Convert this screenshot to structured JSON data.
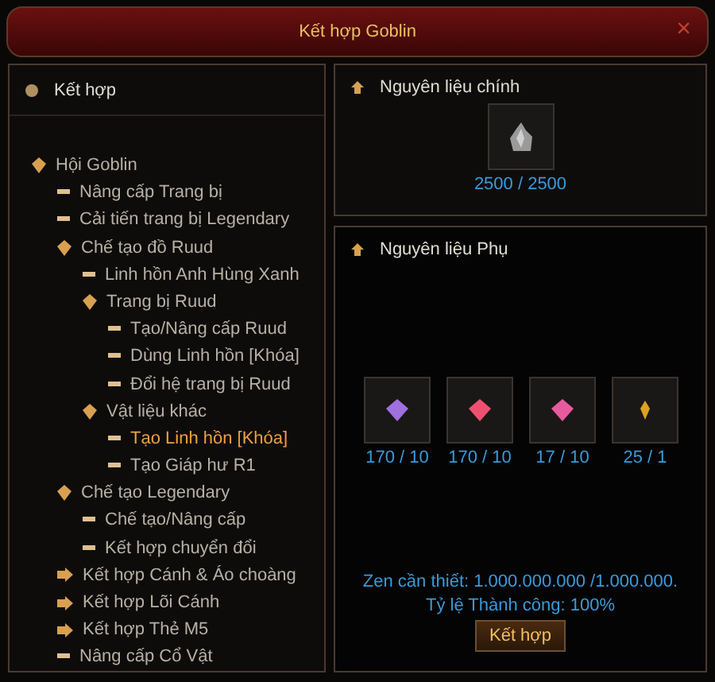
{
  "window": {
    "title": "Kết hợp Goblin",
    "close": "×"
  },
  "sidebar": {
    "title": "Kết hợp",
    "tree": [
      {
        "label": "Hội Goblin",
        "kind": "group",
        "expanded": true,
        "selected": false,
        "children": [
          {
            "label": "Nâng cấp Trang bị",
            "kind": "leaf",
            "selected": false
          },
          {
            "label": "Cải tiến trang bị Legendary",
            "kind": "leaf",
            "selected": false
          },
          {
            "label": "Chế tạo đồ Ruud",
            "kind": "group",
            "expanded": true,
            "selected": false,
            "children": [
              {
                "label": "Linh hồn Anh Hùng Xanh",
                "kind": "leaf",
                "selected": false
              },
              {
                "label": "Trang bị Ruud",
                "kind": "group",
                "expanded": true,
                "selected": false,
                "children": [
                  {
                    "label": "Tạo/Nâng cấp Ruud",
                    "kind": "leaf",
                    "selected": false
                  },
                  {
                    "label": "Dùng Linh hồn [Khóa]",
                    "kind": "leaf",
                    "selected": false
                  },
                  {
                    "label": "Đổi hệ trang bị Ruud",
                    "kind": "leaf",
                    "selected": false
                  }
                ]
              },
              {
                "label": "Vật liệu khác",
                "kind": "group",
                "expanded": true,
                "selected": false,
                "children": [
                  {
                    "label": "Tạo Linh hồn [Khóa]",
                    "kind": "leaf",
                    "selected": true
                  },
                  {
                    "label": "Tạo Giáp hư R1",
                    "kind": "leaf",
                    "selected": false
                  }
                ]
              }
            ]
          },
          {
            "label": "Chế tạo Legendary",
            "kind": "group",
            "expanded": true,
            "selected": false,
            "children": [
              {
                "label": "Chế tạo/Nâng cấp",
                "kind": "leaf",
                "selected": false
              },
              {
                "label": "Kết hợp chuyển đổi",
                "kind": "leaf",
                "selected": false
              }
            ]
          },
          {
            "label": "Kết hợp Cánh & Áo choàng",
            "kind": "group",
            "expanded": false,
            "selected": false
          },
          {
            "label": "Kết hợp Lõi Cánh",
            "kind": "group",
            "expanded": false,
            "selected": false
          },
          {
            "label": "Kết hợp Thẻ M5",
            "kind": "group",
            "expanded": false,
            "selected": false
          },
          {
            "label": "Nâng cấp Cổ Vật",
            "kind": "leaf",
            "selected": false
          }
        ]
      }
    ]
  },
  "main_material": {
    "title": "Nguyên liệu chính",
    "slot": {
      "kind": "ore",
      "count": "2500 / 2500"
    }
  },
  "extra_materials": {
    "title": "Nguyên liệu Phụ",
    "slots": [
      {
        "kind": "gem",
        "color": "#a070e0",
        "count": "170 / 10"
      },
      {
        "kind": "gem",
        "color": "#f05070",
        "count": "170 / 10"
      },
      {
        "kind": "gem",
        "color": "#e85aa0",
        "count": "17 / 10"
      },
      {
        "kind": "shard",
        "color": "#e0a020",
        "count": "25 / 1"
      }
    ]
  },
  "zen": "Zen cần thiết: 1.000.000.000 /1.000.000.",
  "success_rate": "Tỷ lệ Thành công: 100%",
  "combine_button": "Kết hợp"
}
